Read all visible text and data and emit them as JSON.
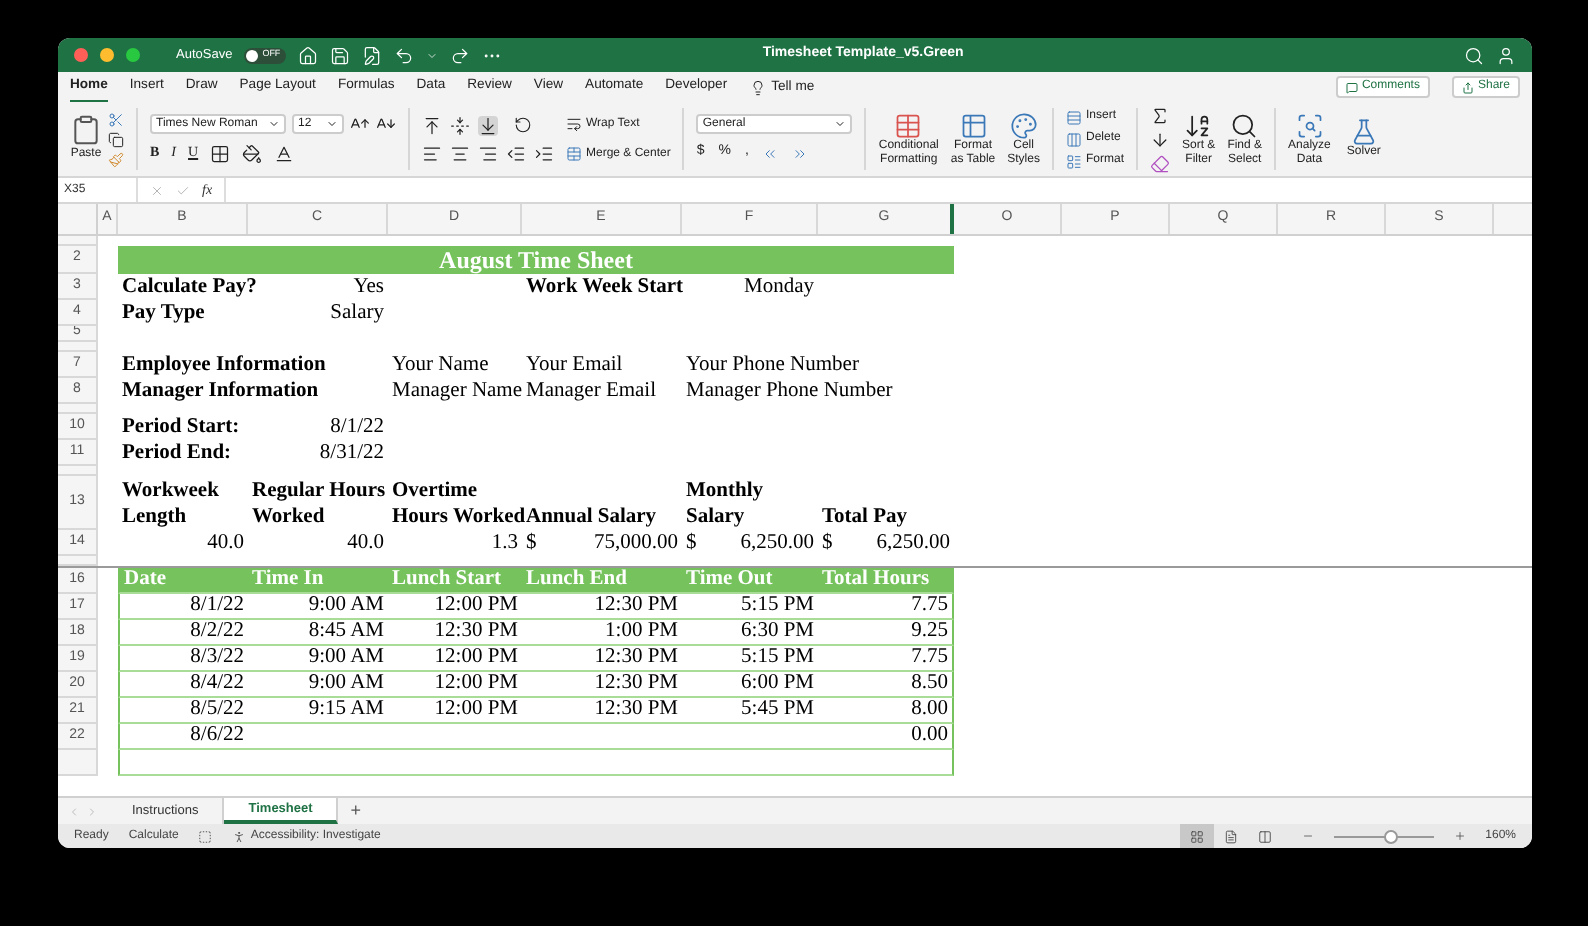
{
  "window": {
    "title": "Timesheet Template_v5.Green",
    "autosave": {
      "label": "AutoSave",
      "state": "OFF",
      "on": false
    }
  },
  "menu_tabs": [
    {
      "label": "Home",
      "selected": true
    },
    {
      "label": "Insert",
      "selected": false
    },
    {
      "label": "Draw",
      "selected": false
    },
    {
      "label": "Page Layout",
      "selected": false
    },
    {
      "label": "Formulas",
      "selected": false
    },
    {
      "label": "Data",
      "selected": false
    },
    {
      "label": "Review",
      "selected": false
    },
    {
      "label": "View",
      "selected": false
    },
    {
      "label": "Automate",
      "selected": false
    },
    {
      "label": "Developer",
      "selected": false
    }
  ],
  "tell_me": "Tell me",
  "comments": "Comments",
  "share": "Share",
  "ribbon": {
    "paste": "Paste",
    "font": "Times New Roman",
    "size": "12",
    "font_styles": [
      "B",
      "I",
      "U"
    ],
    "wrap_text": "Wrap Text",
    "merge": "Merge & Center",
    "number_format": "General",
    "number_symbols": [
      "$",
      "%",
      ","
    ],
    "styles": [
      {
        "lines": [
          "Conditional",
          "Formatting"
        ]
      },
      {
        "lines": [
          "Format",
          "as Table"
        ]
      },
      {
        "lines": [
          "Cell",
          "Styles"
        ]
      }
    ],
    "cells": [
      "Insert",
      "Delete",
      "Format"
    ],
    "editing": [
      {
        "lines": [
          "Sort &",
          "Filter"
        ]
      },
      {
        "lines": [
          "Find &",
          "Select"
        ]
      }
    ],
    "analysis": [
      {
        "lines": [
          "Analyze",
          "Data"
        ]
      },
      {
        "lines": [
          "Solver"
        ]
      }
    ]
  },
  "formula_bar": {
    "name_box": "X35",
    "fx": "fx"
  },
  "columns": [
    "A",
    "B",
    "C",
    "D",
    "E",
    "F",
    "G",
    "O",
    "P",
    "Q",
    "R",
    "S"
  ],
  "rows": [
    {
      "kind": "collapsed"
    },
    {
      "number": "2",
      "kind": "title",
      "cells": {
        "B": {
          "kind": "title",
          "text": "August Time Sheet"
        }
      }
    },
    {
      "number": "3",
      "kind": "plain",
      "cells": {
        "B": {
          "kind": "label",
          "text": "Calculate Pay?"
        },
        "C": {
          "kind": "value",
          "text": "Yes"
        },
        "E": {
          "kind": "label",
          "text": "Work Week Start"
        },
        "F": {
          "kind": "value",
          "text": "Monday"
        }
      }
    },
    {
      "number": "4",
      "kind": "plain",
      "cells": {
        "B": {
          "kind": "label",
          "text": "Pay Type"
        },
        "C": {
          "kind": "value",
          "text": "Salary"
        }
      }
    },
    {
      "number": "5",
      "kind": "short"
    },
    {
      "kind": "collapsed"
    },
    {
      "number": "7",
      "kind": "plain",
      "cells": {
        "B": {
          "kind": "label",
          "text": "Employee Information"
        },
        "D": {
          "kind": "text",
          "text": "Your Name"
        },
        "E": {
          "kind": "text",
          "text": "Your Email"
        },
        "F": {
          "kind": "text",
          "text": "Your Phone Number"
        }
      }
    },
    {
      "number": "8",
      "kind": "plain",
      "cells": {
        "B": {
          "kind": "label",
          "text": "Manager Information"
        },
        "D": {
          "kind": "text",
          "text": "Manager Name"
        },
        "E": {
          "kind": "text",
          "text": "Manager Email"
        },
        "F": {
          "kind": "text",
          "text": "Manager Phone Number"
        }
      }
    },
    {
      "kind": "collapsed"
    },
    {
      "number": "10",
      "kind": "plain",
      "cells": {
        "B": {
          "kind": "label",
          "text": "Period Start:"
        },
        "C": {
          "kind": "value",
          "text": "8/1/22"
        }
      }
    },
    {
      "number": "11",
      "kind": "plain",
      "cells": {
        "B": {
          "kind": "label",
          "text": "Period End:"
        },
        "C": {
          "kind": "value",
          "text": "8/31/22"
        }
      }
    },
    {
      "kind": "collapsed"
    },
    {
      "number": "13",
      "kind": "tall",
      "cells": {
        "B": {
          "kind": "heading",
          "lines": [
            "Workweek",
            "Length"
          ]
        },
        "C": {
          "kind": "heading",
          "lines": [
            "Regular Hours",
            "Worked"
          ]
        },
        "D": {
          "kind": "heading",
          "lines": [
            "Overtime",
            "Hours Worked"
          ]
        },
        "E": {
          "kind": "heading",
          "lines": [
            "Annual Salary"
          ]
        },
        "F": {
          "kind": "heading",
          "lines": [
            "Monthly",
            "Salary"
          ]
        },
        "G": {
          "kind": "heading",
          "lines": [
            "Total Pay"
          ]
        }
      }
    },
    {
      "number": "14",
      "kind": "plain",
      "cells": {
        "B": {
          "kind": "value",
          "text": "40.0"
        },
        "C": {
          "kind": "value",
          "text": "40.0"
        },
        "D": {
          "kind": "value",
          "text": "1.3"
        },
        "E": {
          "kind": "currency",
          "symbol": "$",
          "text": "75,000.00"
        },
        "F": {
          "kind": "currency",
          "symbol": "$",
          "text": "6,250.00"
        },
        "G": {
          "kind": "currency",
          "symbol": "$",
          "text": "6,250.00"
        }
      }
    },
    {
      "kind": "split"
    },
    {
      "number": "16",
      "kind": "table_header",
      "cells": {
        "B": {
          "kind": "column_header",
          "text": "Date"
        },
        "C": {
          "kind": "column_header",
          "text": "Time In"
        },
        "D": {
          "kind": "column_header",
          "text": "Lunch Start"
        },
        "E": {
          "kind": "column_header",
          "text": "Lunch End"
        },
        "F": {
          "kind": "column_header",
          "text": "Time Out"
        },
        "G": {
          "kind": "column_header",
          "text": "Total Hours"
        }
      }
    },
    {
      "number": "17",
      "kind": "table_row",
      "cells": {
        "B": {
          "kind": "value",
          "text": "8/1/22"
        },
        "C": {
          "kind": "value",
          "text": "9:00 AM"
        },
        "D": {
          "kind": "value",
          "text": "12:00 PM"
        },
        "E": {
          "kind": "value",
          "text": "12:30 PM"
        },
        "F": {
          "kind": "value",
          "text": "5:15 PM"
        },
        "G": {
          "kind": "value",
          "text": "7.75"
        }
      }
    },
    {
      "number": "18",
      "kind": "table_row",
      "cells": {
        "B": {
          "kind": "value",
          "text": "8/2/22"
        },
        "C": {
          "kind": "value",
          "text": "8:45 AM"
        },
        "D": {
          "kind": "value",
          "text": "12:30 PM"
        },
        "E": {
          "kind": "value",
          "text": "1:00 PM"
        },
        "F": {
          "kind": "value",
          "text": "6:30 PM"
        },
        "G": {
          "kind": "value",
          "text": "9.25"
        }
      }
    },
    {
      "number": "19",
      "kind": "table_row",
      "cells": {
        "B": {
          "kind": "value",
          "text": "8/3/22"
        },
        "C": {
          "kind": "value",
          "text": "9:00 AM"
        },
        "D": {
          "kind": "value",
          "text": "12:00 PM"
        },
        "E": {
          "kind": "value",
          "text": "12:30 PM"
        },
        "F": {
          "kind": "value",
          "text": "5:15 PM"
        },
        "G": {
          "kind": "value",
          "text": "7.75"
        }
      }
    },
    {
      "number": "20",
      "kind": "table_row",
      "cells": {
        "B": {
          "kind": "value",
          "text": "8/4/22"
        },
        "C": {
          "kind": "value",
          "text": "9:00 AM"
        },
        "D": {
          "kind": "value",
          "text": "12:00 PM"
        },
        "E": {
          "kind": "value",
          "text": "12:30 PM"
        },
        "F": {
          "kind": "value",
          "text": "6:00 PM"
        },
        "G": {
          "kind": "value",
          "text": "8.50"
        }
      }
    },
    {
      "number": "21",
      "kind": "table_row",
      "cells": {
        "B": {
          "kind": "value",
          "text": "8/5/22"
        },
        "C": {
          "kind": "value",
          "text": "9:15 AM"
        },
        "D": {
          "kind": "value",
          "text": "12:00 PM"
        },
        "E": {
          "kind": "value",
          "text": "12:30 PM"
        },
        "F": {
          "kind": "value",
          "text": "5:45 PM"
        },
        "G": {
          "kind": "value",
          "text": "8.00"
        }
      }
    },
    {
      "number": "22",
      "kind": "table_row",
      "cells": {
        "B": {
          "kind": "value",
          "text": "8/6/22"
        },
        "G": {
          "kind": "value",
          "text": "0.00"
        }
      }
    },
    {
      "kind": "table_row"
    }
  ],
  "sheet_tabs": [
    {
      "label": "Instructions",
      "selected": false
    },
    {
      "label": "Timesheet",
      "selected": true
    }
  ],
  "add_sheet": "+",
  "status_bar": {
    "ready": "Ready",
    "calculate": "Calculate",
    "accessibility": "Accessibility: Investigate",
    "views": [
      {
        "selected": true
      },
      {
        "selected": false
      },
      {
        "selected": false
      }
    ],
    "zoom": {
      "level": 0.56,
      "reading": "160%"
    }
  }
}
